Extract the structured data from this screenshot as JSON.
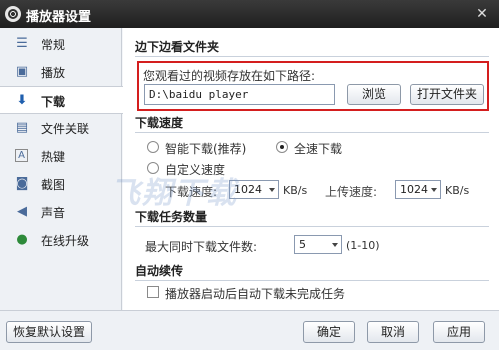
{
  "window": {
    "title": "播放器设置",
    "close_glyph": "✕"
  },
  "sidebar": {
    "items": [
      {
        "label": "常规",
        "icon": "list-icon"
      },
      {
        "label": "播放",
        "icon": "play-icon"
      },
      {
        "label": "下载",
        "icon": "download-icon"
      },
      {
        "label": "文件关联",
        "icon": "file-icon"
      },
      {
        "label": "热键",
        "icon": "hotkey-icon"
      },
      {
        "label": "截图",
        "icon": "camera-icon"
      },
      {
        "label": "声音",
        "icon": "speaker-icon"
      },
      {
        "label": "在线升级",
        "icon": "globe-icon"
      }
    ],
    "active_index": 2
  },
  "path_section": {
    "title": "边下边看文件夹",
    "prompt": "您观看过的视频存放在如下路径:",
    "path_value": "D:\\baidu player",
    "browse_label": "浏览",
    "open_folder_label": "打开文件夹",
    "highlight_color": "#d41e1e"
  },
  "speed_section": {
    "title": "下载速度",
    "smart_label": "智能下载(推荐)",
    "full_label": "全速下载",
    "custom_label": "自定义速度",
    "selected": "全速下载",
    "download_speed_label": "下载速度:",
    "download_speed_value": "1024",
    "upload_speed_label": "上传速度:",
    "upload_speed_value": "1024",
    "unit": "KB/s"
  },
  "task_section": {
    "title": "下载任务数量",
    "max_label": "最大同时下载文件数:",
    "max_value": "5",
    "range_hint": "(1-10)"
  },
  "resume_section": {
    "title": "自动续传",
    "auto_resume_label": "播放器启动后自动下载未完成任务",
    "auto_resume_checked": false
  },
  "footer": {
    "restore_label": "恢复默认设置",
    "ok_label": "确定",
    "cancel_label": "取消",
    "apply_label": "应用"
  },
  "watermark": "飞翔下载"
}
